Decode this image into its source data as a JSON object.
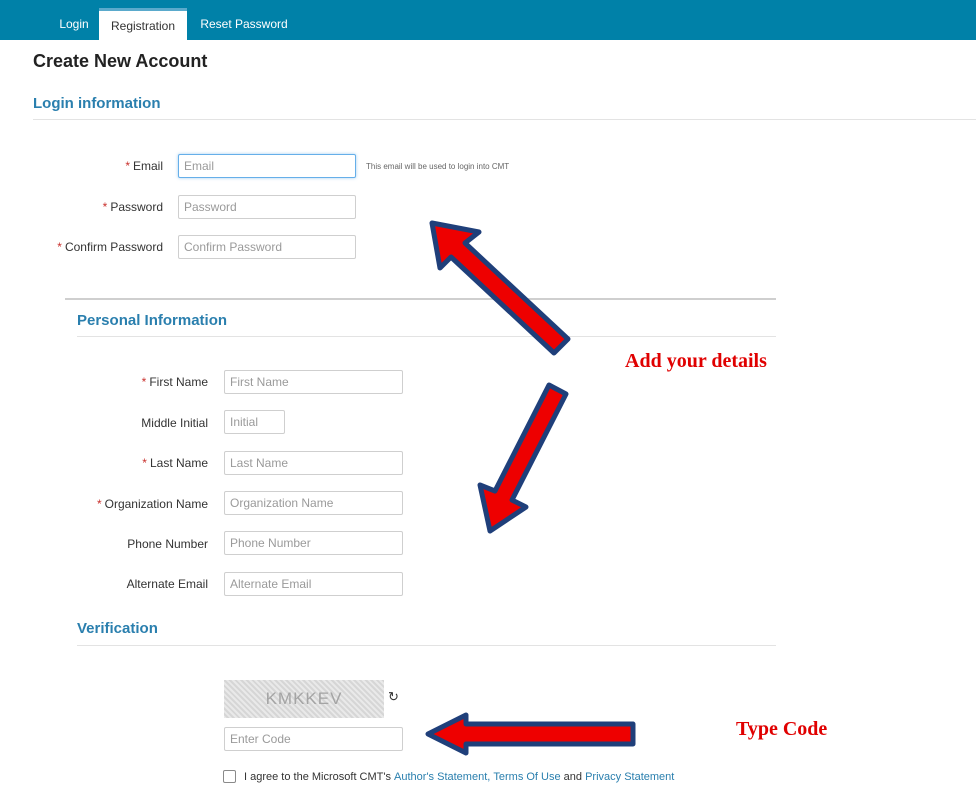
{
  "nav": {
    "tabs": [
      {
        "label": "Login"
      },
      {
        "label": "Registration",
        "active": true
      },
      {
        "label": "Reset Password"
      }
    ]
  },
  "page_title": "Create New Account",
  "login_section": {
    "title": "Login information",
    "email": {
      "label": "Email",
      "placeholder": "Email",
      "required": true,
      "hint": "This email will be used to login into CMT"
    },
    "password": {
      "label": "Password",
      "placeholder": "Password",
      "required": true
    },
    "confirm_password": {
      "label": "Confirm Password",
      "placeholder": "Confirm Password",
      "required": true
    }
  },
  "personal_section": {
    "title": "Personal Information",
    "first_name": {
      "label": "First Name",
      "placeholder": "First Name",
      "required": true
    },
    "middle_initial": {
      "label": "Middle Initial",
      "placeholder": "Initial",
      "required": false
    },
    "last_name": {
      "label": "Last Name",
      "placeholder": "Last Name",
      "required": true
    },
    "organization": {
      "label": "Organization Name",
      "placeholder": "Organization Name",
      "required": true
    },
    "phone": {
      "label": "Phone Number",
      "placeholder": "Phone Number",
      "required": false
    },
    "alt_email": {
      "label": "Alternate Email",
      "placeholder": "Alternate Email",
      "required": false
    }
  },
  "verification_section": {
    "title": "Verification",
    "captcha_text": "KMKKEV",
    "code_placeholder": "Enter Code",
    "refresh_icon": "refresh-icon"
  },
  "agreement": {
    "prefix": "I agree to the Microsoft CMT's",
    "link1": "Author's Statement,",
    "link2": "Terms Of Use",
    "and": "and",
    "link3": "Privacy Statement"
  },
  "annotations": {
    "details_note": "Add your details",
    "code_note": "Type Code",
    "arrow_color": "#ee0000",
    "arrow_outline": "#1f3f7a"
  },
  "colors": {
    "nav_bg": "#0081a8",
    "section_title": "#2a7fae",
    "required": "#c9302c",
    "link": "#2a7fae"
  }
}
